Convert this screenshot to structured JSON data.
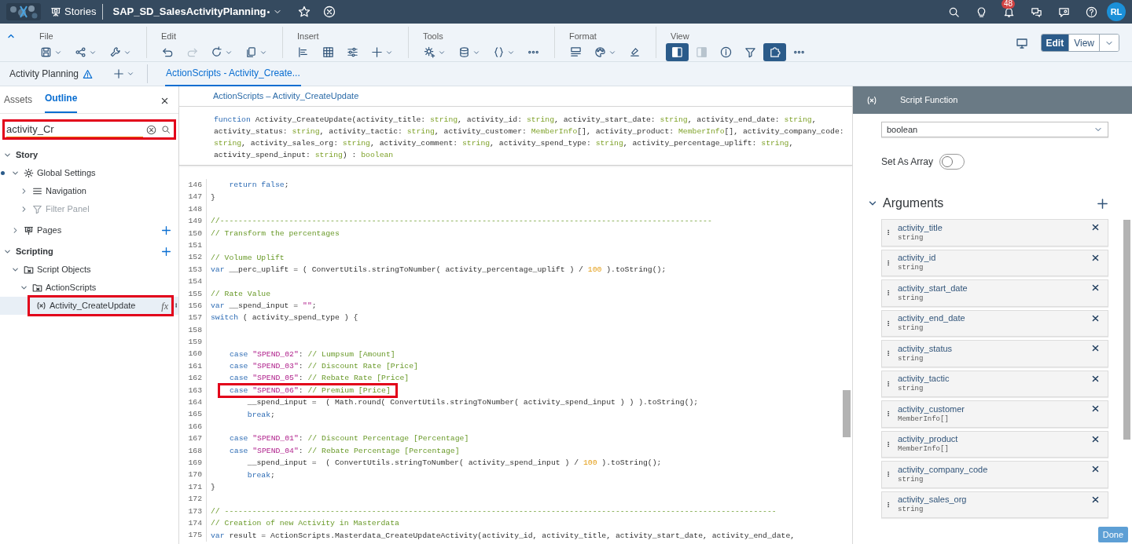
{
  "shell": {
    "app": "Stories",
    "document": "SAP_SD_SalesActivityPlanning",
    "modified_mark": "•",
    "notifications": "48",
    "avatar": "RL"
  },
  "toolbar": {
    "groups": [
      {
        "label": "File",
        "buttons": [
          {
            "kind": "save",
            "dropdown": true,
            "disabled": false,
            "active": false
          },
          {
            "kind": "share",
            "dropdown": true,
            "disabled": false,
            "active": false
          },
          {
            "kind": "wrench",
            "dropdown": true,
            "disabled": false,
            "active": false
          }
        ]
      },
      {
        "label": "Edit",
        "buttons": [
          {
            "kind": "undo",
            "dropdown": false,
            "disabled": false,
            "active": false
          },
          {
            "kind": "redo",
            "dropdown": false,
            "disabled": true,
            "active": false
          },
          {
            "kind": "refresh",
            "dropdown": true,
            "disabled": false,
            "active": false
          },
          {
            "kind": "copy",
            "dropdown": true,
            "disabled": false,
            "active": false
          }
        ]
      },
      {
        "label": "Insert",
        "buttons": [
          {
            "kind": "chart",
            "dropdown": false,
            "disabled": false,
            "active": false
          },
          {
            "kind": "table",
            "dropdown": false,
            "disabled": false,
            "active": false
          },
          {
            "kind": "sliders",
            "dropdown": false,
            "disabled": false,
            "active": false
          },
          {
            "kind": "plus",
            "dropdown": true,
            "disabled": false,
            "active": false
          }
        ]
      },
      {
        "label": "Tools",
        "buttons": [
          {
            "kind": "gear",
            "dropdown": true,
            "disabled": false,
            "active": false
          },
          {
            "kind": "database",
            "dropdown": true,
            "disabled": false,
            "active": false
          },
          {
            "kind": "braces",
            "dropdown": true,
            "disabled": false,
            "active": false
          },
          {
            "kind": "more",
            "dropdown": false,
            "disabled": false,
            "active": false
          }
        ]
      },
      {
        "label": "Format",
        "buttons": [
          {
            "kind": "layout",
            "dropdown": false,
            "disabled": false,
            "active": false
          },
          {
            "kind": "palette",
            "dropdown": true,
            "disabled": false,
            "active": false
          },
          {
            "kind": "brush",
            "dropdown": false,
            "disabled": false,
            "active": false
          }
        ]
      },
      {
        "label": "View",
        "buttons": [
          {
            "kind": "panel-left",
            "dropdown": false,
            "disabled": false,
            "active": true
          },
          {
            "kind": "panel-right",
            "dropdown": false,
            "disabled": true,
            "active": false
          },
          {
            "kind": "info",
            "dropdown": false,
            "disabled": false,
            "active": false
          },
          {
            "kind": "filter",
            "dropdown": false,
            "disabled": false,
            "active": false
          },
          {
            "kind": "puzzle",
            "dropdown": false,
            "disabled": false,
            "active": true
          },
          {
            "kind": "more",
            "dropdown": false,
            "disabled": false,
            "active": false
          }
        ]
      }
    ],
    "mode_switch": [
      {
        "label": "Edit",
        "selected": true
      },
      {
        "label": "View",
        "selected": false
      }
    ]
  },
  "tabs": {
    "page": "Activity Planning",
    "open": [
      {
        "label": "ActionScripts - Activity_Create...",
        "selected": true
      }
    ]
  },
  "left_panel": {
    "tabs": [
      {
        "label": "Assets",
        "selected": false
      },
      {
        "label": "Outline",
        "selected": true
      }
    ],
    "search": {
      "value": "activity_Cr",
      "highlighted": true
    },
    "tree": [
      {
        "label": "Story",
        "kind": "section",
        "expanded": true,
        "children": [
          {
            "label": "Global Settings",
            "kind": "settings",
            "expanded": true,
            "dot": true,
            "children": [
              {
                "label": "Navigation",
                "kind": "navigation",
                "expanded": false,
                "disabled": false
              },
              {
                "label": "Filter Panel",
                "kind": "filter",
                "expanded": false,
                "disabled": true
              }
            ]
          },
          {
            "label": "Pages",
            "kind": "pages",
            "expanded": false,
            "add_button": true
          }
        ]
      },
      {
        "label": "Scripting",
        "kind": "section",
        "expanded": true,
        "add_button": true,
        "children": [
          {
            "label": "Script Objects",
            "kind": "folder",
            "expanded": true,
            "children": [
              {
                "label": "ActionScripts",
                "kind": "folder",
                "expanded": true,
                "children": [
                  {
                    "label": "Activity_CreateUpdate",
                    "kind": "function",
                    "selected": true,
                    "highlighted": true,
                    "badge": "fx"
                  }
                ]
              }
            ]
          }
        ]
      }
    ]
  },
  "editor": {
    "title": "ActionScripts – Activity_CreateUpdate",
    "signature": [
      [
        {
          "kind": "kw",
          "text": "function"
        },
        {
          "kind": "tx",
          "text": " Activity_CreateUpdate(activity_title: "
        },
        {
          "kind": "type",
          "text": "string"
        },
        {
          "kind": "tx",
          "text": ", activity_id: "
        },
        {
          "kind": "type",
          "text": "string"
        },
        {
          "kind": "tx",
          "text": ", activity_start_date: "
        },
        {
          "kind": "type",
          "text": "string"
        },
        {
          "kind": "tx",
          "text": ", activity_end_date: "
        },
        {
          "kind": "type",
          "text": "string"
        },
        {
          "kind": "tx",
          "text": ","
        }
      ],
      [
        {
          "kind": "tx",
          "text": "activity_status: "
        },
        {
          "kind": "type",
          "text": "string"
        },
        {
          "kind": "tx",
          "text": ", activity_tactic: "
        },
        {
          "kind": "type",
          "text": "string"
        },
        {
          "kind": "tx",
          "text": ", activity_customer: "
        },
        {
          "kind": "type",
          "text": "MemberInfo"
        },
        {
          "kind": "tx",
          "text": "[], activity_product: "
        },
        {
          "kind": "type",
          "text": "MemberInfo"
        },
        {
          "kind": "tx",
          "text": "[], activity_company_code:"
        }
      ],
      [
        {
          "kind": "type",
          "text": "string"
        },
        {
          "kind": "tx",
          "text": ", activity_sales_org: "
        },
        {
          "kind": "type",
          "text": "string"
        },
        {
          "kind": "tx",
          "text": ", activity_comment: "
        },
        {
          "kind": "type",
          "text": "string"
        },
        {
          "kind": "tx",
          "text": ", activity_spend_type: "
        },
        {
          "kind": "type",
          "text": "string"
        },
        {
          "kind": "tx",
          "text": ", activity_percentage_uplift: "
        },
        {
          "kind": "type",
          "text": "string"
        },
        {
          "kind": "tx",
          "text": ","
        }
      ],
      [
        {
          "kind": "tx",
          "text": "activity_spend_input: "
        },
        {
          "kind": "type",
          "text": "string"
        },
        {
          "kind": "tx",
          "text": ") : "
        },
        {
          "kind": "type",
          "text": "boolean"
        }
      ]
    ],
    "lines": [
      {
        "no": "146",
        "code": [
          {
            "kind": "kw",
            "text": "    return false"
          },
          {
            "kind": "tx",
            "text": ";"
          }
        ]
      },
      {
        "no": "147",
        "code": [
          {
            "kind": "tx",
            "text": "}"
          }
        ]
      },
      {
        "no": "148"
      },
      {
        "no": "149",
        "code": [
          {
            "kind": "cm",
            "text": "//-----------------------------------------------------------------------------------------------------------"
          }
        ]
      },
      {
        "no": "150",
        "code": [
          {
            "kind": "cm",
            "text": "// Transform the percentages"
          }
        ]
      },
      {
        "no": "151"
      },
      {
        "no": "152",
        "code": [
          {
            "kind": "cm",
            "text": "// Volume Uplift"
          }
        ]
      },
      {
        "no": "153",
        "code": [
          {
            "kind": "kw",
            "text": "var"
          },
          {
            "kind": "tx",
            "text": " __perc_uplift = ( ConvertUtils.stringToNumber( activity_percentage_uplift ) / "
          },
          {
            "kind": "num",
            "text": "100"
          },
          {
            "kind": "tx",
            "text": " ).toString();"
          }
        ]
      },
      {
        "no": "154"
      },
      {
        "no": "155",
        "code": [
          {
            "kind": "cm",
            "text": "// Rate Value"
          }
        ]
      },
      {
        "no": "156",
        "code": [
          {
            "kind": "kw",
            "text": "var"
          },
          {
            "kind": "tx",
            "text": " __spend_input = "
          },
          {
            "kind": "str",
            "text": "\"\""
          },
          {
            "kind": "tx",
            "text": ";"
          }
        ]
      },
      {
        "no": "157",
        "code": [
          {
            "kind": "kw",
            "text": "switch"
          },
          {
            "kind": "tx",
            "text": " ( activity_spend_type ) {"
          }
        ]
      },
      {
        "no": "158"
      },
      {
        "no": "159"
      },
      {
        "no": "160",
        "highlighted": false,
        "code": [
          {
            "kind": "kw",
            "text": "case"
          },
          {
            "kind": "str",
            "text": " \"SPEND_02\""
          },
          {
            "kind": "tx",
            "text": ":"
          },
          {
            "kind": "cm",
            "text": " // Lumpsum [Amount]"
          }
        ]
      },
      {
        "no": "161",
        "highlighted": false,
        "code": [
          {
            "kind": "kw",
            "text": "case"
          },
          {
            "kind": "str",
            "text": " \"SPEND_03\""
          },
          {
            "kind": "tx",
            "text": ":"
          },
          {
            "kind": "cm",
            "text": " // Discount Rate [Price]"
          }
        ]
      },
      {
        "no": "162",
        "highlighted": false,
        "code": [
          {
            "kind": "kw",
            "text": "case"
          },
          {
            "kind": "str",
            "text": " \"SPEND_05\""
          },
          {
            "kind": "tx",
            "text": ":"
          },
          {
            "kind": "cm",
            "text": " // Rebate Rate [Price]"
          }
        ]
      },
      {
        "no": "163",
        "highlighted": true,
        "code": [
          {
            "kind": "kw",
            "text": "case"
          },
          {
            "kind": "str",
            "text": " \"SPEND_06\""
          },
          {
            "kind": "tx",
            "text": ":"
          },
          {
            "kind": "cm",
            "text": " // Premium [Price]"
          }
        ]
      },
      {
        "no": "164",
        "code": [
          {
            "kind": "tx",
            "text": "        __spend_input =  ( Math.round( ConvertUtils.stringToNumber( activity_spend_input ) ) ).toString();"
          }
        ]
      },
      {
        "no": "165",
        "code": [
          {
            "kind": "kw",
            "text": "        break"
          },
          {
            "kind": "tx",
            "text": ";"
          }
        ]
      },
      {
        "no": "166"
      },
      {
        "no": "167",
        "highlighted": false,
        "code": [
          {
            "kind": "kw",
            "text": "case"
          },
          {
            "kind": "str",
            "text": " \"SPEND_01\""
          },
          {
            "kind": "tx",
            "text": ":"
          },
          {
            "kind": "cm",
            "text": " // Discount Percentage [Percentage]"
          }
        ]
      },
      {
        "no": "168",
        "highlighted": false,
        "code": [
          {
            "kind": "kw",
            "text": "case"
          },
          {
            "kind": "str",
            "text": " \"SPEND_04\""
          },
          {
            "kind": "tx",
            "text": ":"
          },
          {
            "kind": "cm",
            "text": " // Rebate Percentage [Percentage]"
          }
        ]
      },
      {
        "no": "169",
        "code": [
          {
            "kind": "tx",
            "text": "        __spend_input =  ( ConvertUtils.stringToNumber( activity_spend_input ) / "
          },
          {
            "kind": "num",
            "text": "100"
          },
          {
            "kind": "tx",
            "text": " ).toString();"
          }
        ]
      },
      {
        "no": "170",
        "code": [
          {
            "kind": "kw",
            "text": "        break"
          },
          {
            "kind": "tx",
            "text": ";"
          }
        ]
      },
      {
        "no": "171",
        "code": [
          {
            "kind": "tx",
            "text": "}"
          }
        ]
      },
      {
        "no": "172"
      },
      {
        "no": "173",
        "code": [
          {
            "kind": "cm",
            "text": "// ------------------------------------------------------------------------------------------------------------------------"
          }
        ]
      },
      {
        "no": "174",
        "code": [
          {
            "kind": "cm",
            "text": "// Creation of new Activity in Masterdata"
          }
        ]
      },
      {
        "no": "175",
        "code": [
          {
            "kind": "kw",
            "text": "var"
          },
          {
            "kind": "tx",
            "text": " result = ActionScripts.Masterdata_CreateUpdateActivity(activity_id, activity_title, activity_start_date, activity_end_date,"
          }
        ]
      }
    ]
  },
  "right_panel": {
    "title": "Script Function",
    "return_type": "boolean",
    "set_as_array": {
      "label": "Set As Array",
      "on": false
    },
    "arguments_heading": "Arguments",
    "arguments_expanded": true,
    "arguments": [
      {
        "name": "activity_title",
        "type": "string"
      },
      {
        "name": "activity_id",
        "type": "string"
      },
      {
        "name": "activity_start_date",
        "type": "string"
      },
      {
        "name": "activity_end_date",
        "type": "string"
      },
      {
        "name": "activity_status",
        "type": "string"
      },
      {
        "name": "activity_tactic",
        "type": "string"
      },
      {
        "name": "activity_customer",
        "type": "MemberInfo[]"
      },
      {
        "name": "activity_product",
        "type": "MemberInfo[]"
      },
      {
        "name": "activity_company_code",
        "type": "string"
      },
      {
        "name": "activity_sales_org",
        "type": "string"
      }
    ],
    "done": "Done"
  }
}
